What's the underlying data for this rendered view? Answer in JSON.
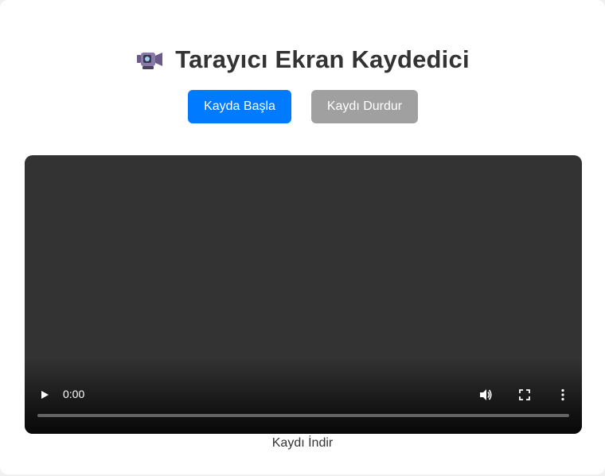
{
  "header": {
    "icon": "video-camera-icon",
    "title": "Tarayıcı Ekran Kaydedici"
  },
  "buttons": {
    "start_label": "Kayda Başla",
    "stop_label": "Kaydı Durdur"
  },
  "video": {
    "time": "0:00",
    "progress": 0,
    "icons": [
      "play-icon",
      "volume-icon",
      "fullscreen-icon",
      "more-options-icon"
    ]
  },
  "download": {
    "label": "Kaydı İndir"
  },
  "colors": {
    "primary": "#007bff",
    "disabled": "#a0a0a0",
    "video_bg": "#333333",
    "text": "#333333"
  }
}
